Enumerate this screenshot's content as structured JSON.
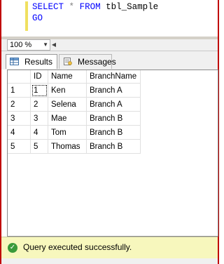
{
  "editor": {
    "line1": {
      "kw": "SELECT",
      "op": "*",
      "kw2": "FROM",
      "table": "tbl_Sample"
    },
    "line2": {
      "kw": "GO"
    }
  },
  "zoom": {
    "value": "100 %"
  },
  "tabs": [
    {
      "label": "Results",
      "active": true
    },
    {
      "label": "Messages",
      "active": false
    }
  ],
  "grid": {
    "columns": [
      "ID",
      "Name",
      "BranchName"
    ],
    "rows": [
      {
        "row": "1",
        "ID": "1",
        "Name": "Ken",
        "BranchName": "Branch A"
      },
      {
        "row": "2",
        "ID": "2",
        "Name": "Selena",
        "BranchName": "Branch A"
      },
      {
        "row": "3",
        "ID": "3",
        "Name": "Mae",
        "BranchName": "Branch B"
      },
      {
        "row": "4",
        "ID": "4",
        "Name": "Tom",
        "BranchName": "Branch B"
      },
      {
        "row": "5",
        "ID": "5",
        "Name": "Thomas",
        "BranchName": "Branch B"
      }
    ]
  },
  "status": {
    "message": "Query executed successfully.",
    "color": "#f7f7bd",
    "icon": "success-check-icon"
  },
  "colors": {
    "keyword": "#0000ff",
    "window_border": "#c00000"
  }
}
